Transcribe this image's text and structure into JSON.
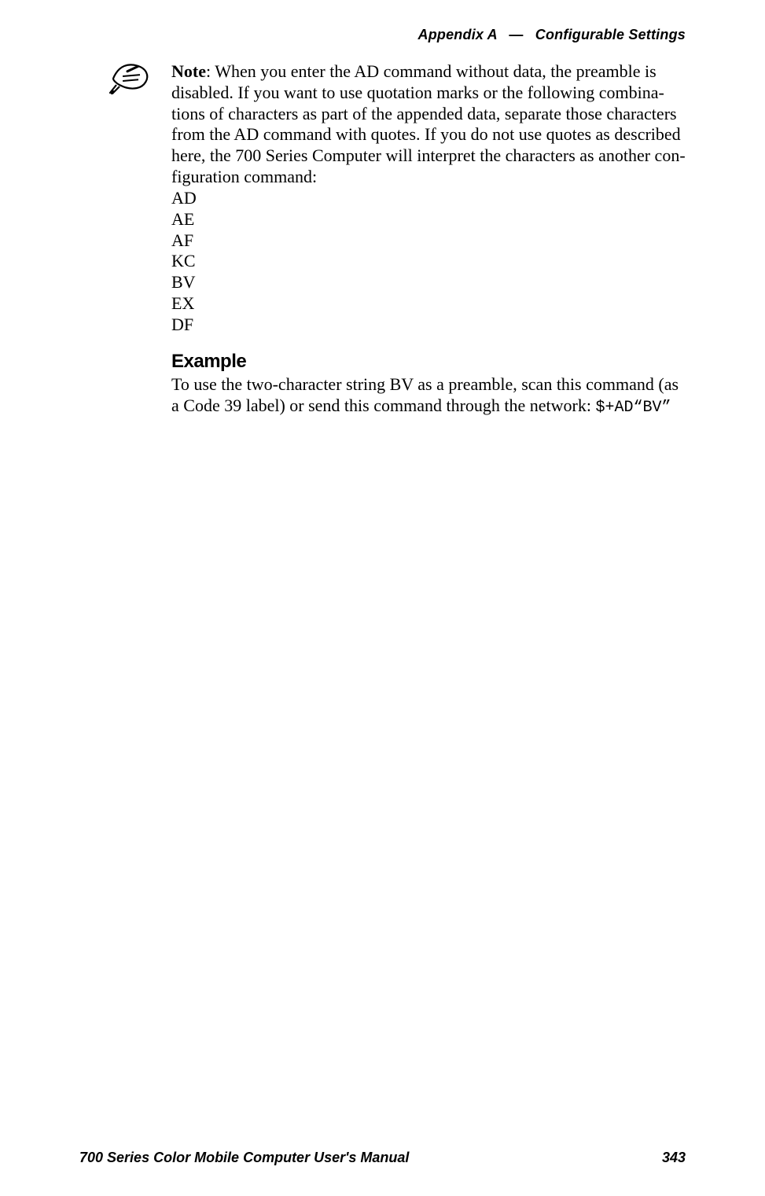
{
  "header": {
    "appendix": "Appendix A",
    "dash": "—",
    "section": "Configurable Settings"
  },
  "note": {
    "label": "Note",
    "body": ": When you enter the AD command without data, the preamble is disabled. If you want to use quotation marks or the following combina­tions of characters as part of the appended data, separate those characters from the AD command with quotes. If you do not use quotes as described here, the 700 Series Computer will interpret the characters as another con­figuration command:",
    "codes": [
      "AD",
      "AE",
      "AF",
      "KC",
      "BV",
      "EX",
      "DF"
    ]
  },
  "example": {
    "heading": "Example",
    "body_pre": "To use the two-character string BV as a preamble, scan this command (as a Code 39 label) or send this command through the network: ",
    "command": "$+AD“BV”"
  },
  "footer": {
    "manual": "700 Series Color Mobile Computer User's Manual",
    "page": "343"
  }
}
